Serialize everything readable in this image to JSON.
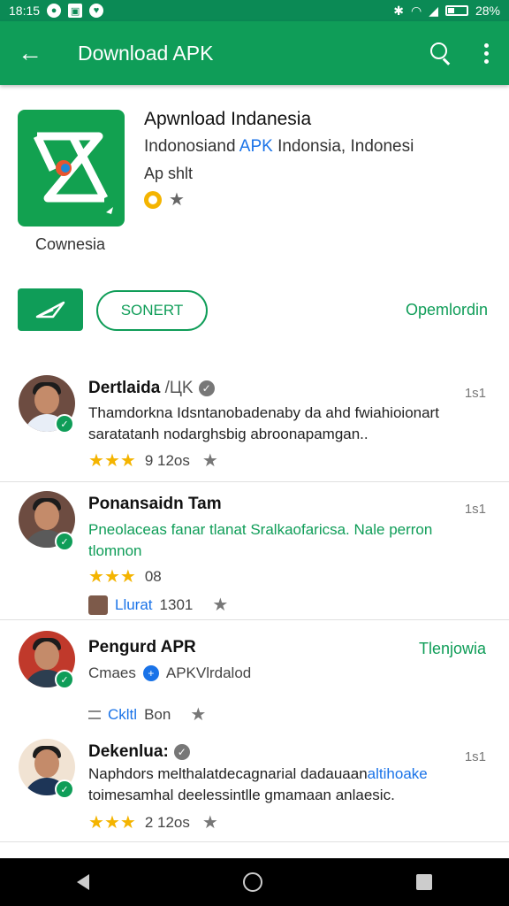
{
  "status_bar": {
    "time": "18:15",
    "battery": "28%"
  },
  "app_bar": {
    "title": "Download APK"
  },
  "app": {
    "name": "Apwnload Indanesia",
    "developer_prefix": "Indonosiand ",
    "developer_link": "APK",
    "developer_suffix": " Indonsia, Indonesi",
    "meta": "Ap shlt",
    "icon_caption": "Cownesia"
  },
  "actions": {
    "outline_label": "SONERT",
    "text_link": "Opemlordin"
  },
  "reviews": [
    {
      "name": "Dertlaida",
      "name_suffix": " /ЦK",
      "time": "1s1",
      "text": "Thamdorkna Idsntanobadenaby da ahd fwiahioionart saratatanh nodarghsbig abroonapamgan..",
      "rating_value": "9  12os"
    },
    {
      "name": "Ponansaidn Tam",
      "time": "1s1",
      "text": "Pneolaceas fanar tlanat Sralkaofaricsa. Nale perron tlomnon",
      "rating_value": "08",
      "sub_link": "Llurat",
      "sub_value": "1301"
    },
    {
      "name": "Pengurd APR",
      "time": "Tlenjowia",
      "sub_text_before": "Cmaes",
      "sub_text_after": "APKVlrdalod",
      "sub_link": "Ckltl",
      "sub_value": "Bon"
    },
    {
      "name": "Dekenlua:",
      "time": "1s1",
      "text_before": "Naphdors melthalatdecagnarial dadauaan",
      "text_link": "altihoake",
      "text_after": " toimesamhal deelessintlle gmamaan anlaesic.",
      "rating_value": "2 12os"
    }
  ]
}
